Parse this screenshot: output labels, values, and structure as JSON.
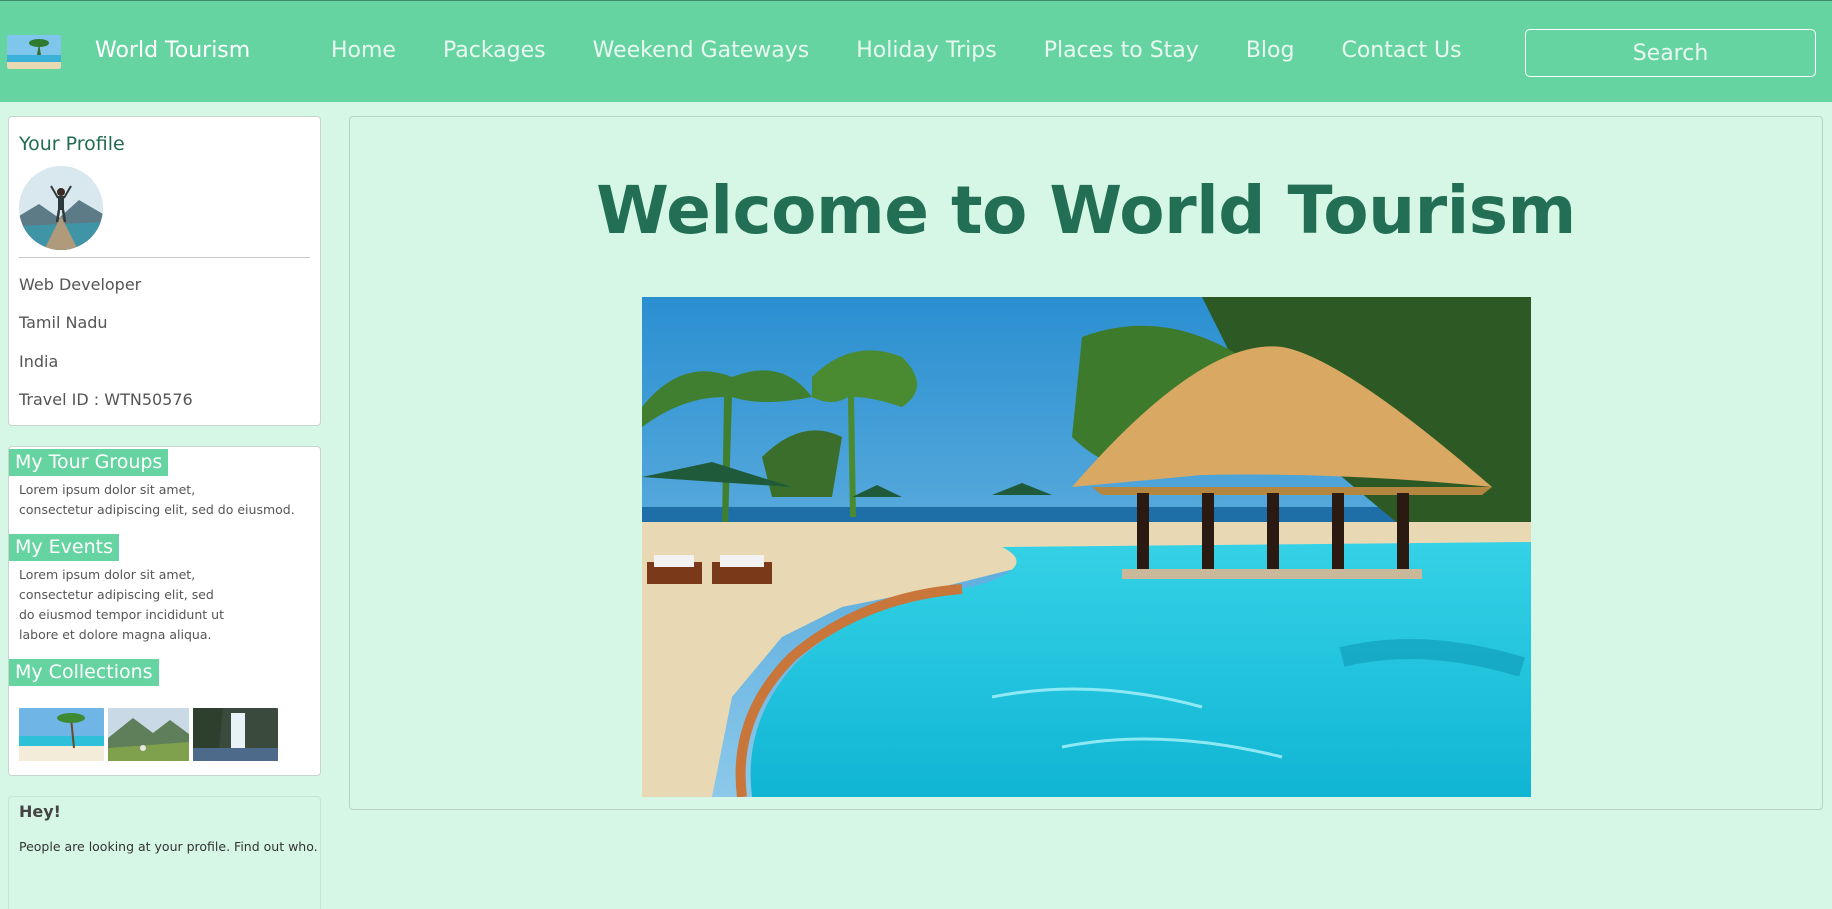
{
  "navbar": {
    "brand_name": "World Tourism",
    "links": [
      "Home",
      "Packages",
      "Weekend Gateways",
      "Holiday Trips",
      "Places to Stay",
      "Blog",
      "Contact Us"
    ],
    "search_placeholder": "Search"
  },
  "profile": {
    "title": "Your Profile",
    "occupation": "Web Developer",
    "state": "Tamil Nadu",
    "country": "India",
    "travel_id": "Travel ID : WTN50576"
  },
  "groups": {
    "tour_groups_title": "My Tour Groups",
    "tour_groups_text": "Lorem ipsum dolor sit amet,\nconsectetur adipiscing elit, sed do eiusmod.",
    "events_title": "My Events",
    "events_text": "Lorem ipsum dolor sit amet,\nconsectetur adipiscing elit, sed\ndo eiusmod tempor incididunt ut\nlabore et dolore magna aliqua.",
    "collections_title": "My Collections"
  },
  "hey": {
    "title": "Hey!",
    "text": "People are looking at your profile. Find out who."
  },
  "main": {
    "welcome": "Welcome to World Tourism"
  },
  "colors": {
    "navbar": "#66d4a1",
    "page_bg": "#d6f7e6",
    "heading": "#236f56"
  }
}
